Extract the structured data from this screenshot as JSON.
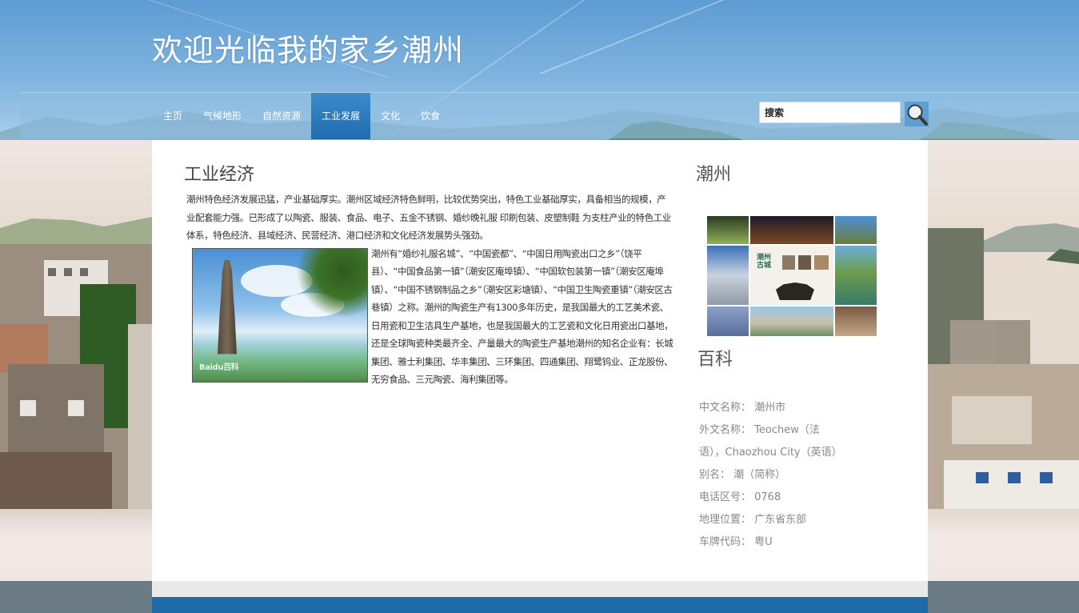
{
  "site": {
    "title": "欢迎光临我的家乡潮州"
  },
  "nav": {
    "items": [
      {
        "label": "主页",
        "active": false
      },
      {
        "label": "气候地形",
        "active": false
      },
      {
        "label": "自然资源",
        "active": false
      },
      {
        "label": "工业发展",
        "active": true
      },
      {
        "label": "文化",
        "active": false
      },
      {
        "label": "饮食",
        "active": false
      }
    ],
    "search_value": "搜索",
    "search_icon": "magnifier-icon"
  },
  "main": {
    "title": "工业经济",
    "paragraph1": "潮州特色经济发展迅猛，产业基础厚实。潮州区域经济特色鲜明，比较优势突出，特色工业基础厚实，具备相当的规模，产业配套能力强。已形成了以陶瓷、服装、食品、电子、五金不锈钢、婚纱晚礼服 印刷包装、皮塑制鞋 为支柱产业的特色工业体系，特色经济、县域经济、民营经济、港口经济和文化经济发展势头强劲。",
    "paragraph2": "潮州有“婚纱礼服名城”、“中国瓷都”、“中国日用陶瓷出口之乡”（饶平县）、“中国食品第一镇”（潮安区庵埠镇）、“中国软包装第一镇”（潮安区庵埠镇）、“中国不锈钢制品之乡”（潮安区彩塘镇）、“中国卫生陶瓷重镇”（潮安区古巷镇）之称。潮州的陶瓷生产有1300多年历史，是我国最大的工艺美术瓷、日用瓷和卫生洁具生产基地，也是我国最大的工艺瓷和文化日用瓷出口基地，还是全球陶瓷种类最齐全、产量最大的陶瓷生产基地潮州的知名企业有：长城集团、雅士利集团、华丰集团、三环集团、四通集团、翔鹭钨业、正龙股份、无穷食品、三元陶瓷、海利集团等。",
    "image_watermark": "Baidu百科"
  },
  "sidebar": {
    "heading1": "潮州",
    "mosaic_text": "潮州\n古城",
    "heading2": "百科",
    "info": [
      "中文名称： 潮州市",
      "外文名称： Teochew（法",
      "语），Chaozhou City（英语）",
      "别名： 潮（简称）",
      "电话区号： 0768",
      "地理位置： 广东省东部",
      "车牌代码： 粤U"
    ]
  },
  "colors": {
    "header_blue": "#5d9cd3",
    "nav_active": "#1f6cae",
    "footer_blue": "#1f6aa8",
    "footer_gray": "#6b7b86"
  }
}
